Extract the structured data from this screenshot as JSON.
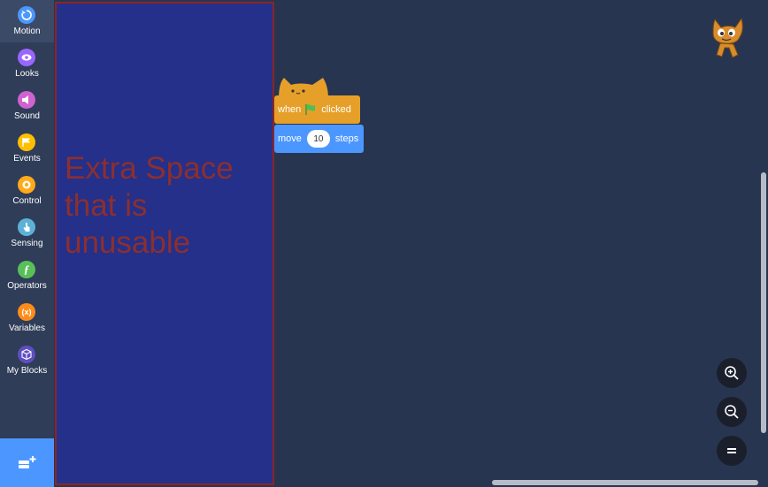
{
  "categories": [
    {
      "id": "motion",
      "label": "Motion",
      "color": "#4c97ff",
      "selected": true
    },
    {
      "id": "looks",
      "label": "Looks",
      "color": "#9966ff"
    },
    {
      "id": "sound",
      "label": "Sound",
      "color": "#cf63cf"
    },
    {
      "id": "events",
      "label": "Events",
      "color": "#ffbf00"
    },
    {
      "id": "control",
      "label": "Control",
      "color": "#ffab19"
    },
    {
      "id": "sensing",
      "label": "Sensing",
      "color": "#5cb1d6"
    },
    {
      "id": "operators",
      "label": "Operators",
      "color": "#59c059"
    },
    {
      "id": "variables",
      "label": "Variables",
      "color": "#ff8c1a"
    },
    {
      "id": "myblocks",
      "label": "My Blocks",
      "color": "#5d4fc0"
    }
  ],
  "flyout": {
    "note": "Extra Space that is unusable"
  },
  "blocks": {
    "hat": {
      "prefix": "when",
      "suffix": "clicked"
    },
    "move": {
      "prefix": "move",
      "value": "10",
      "suffix": "steps"
    }
  },
  "icons": {
    "extension": "add-extension-icon",
    "flag": "green-flag-icon",
    "sprite": "scratch-cat-icon",
    "zoom_in": "zoom-in-icon",
    "zoom_out": "zoom-out-icon",
    "zoom_reset": "zoom-reset-icon"
  }
}
